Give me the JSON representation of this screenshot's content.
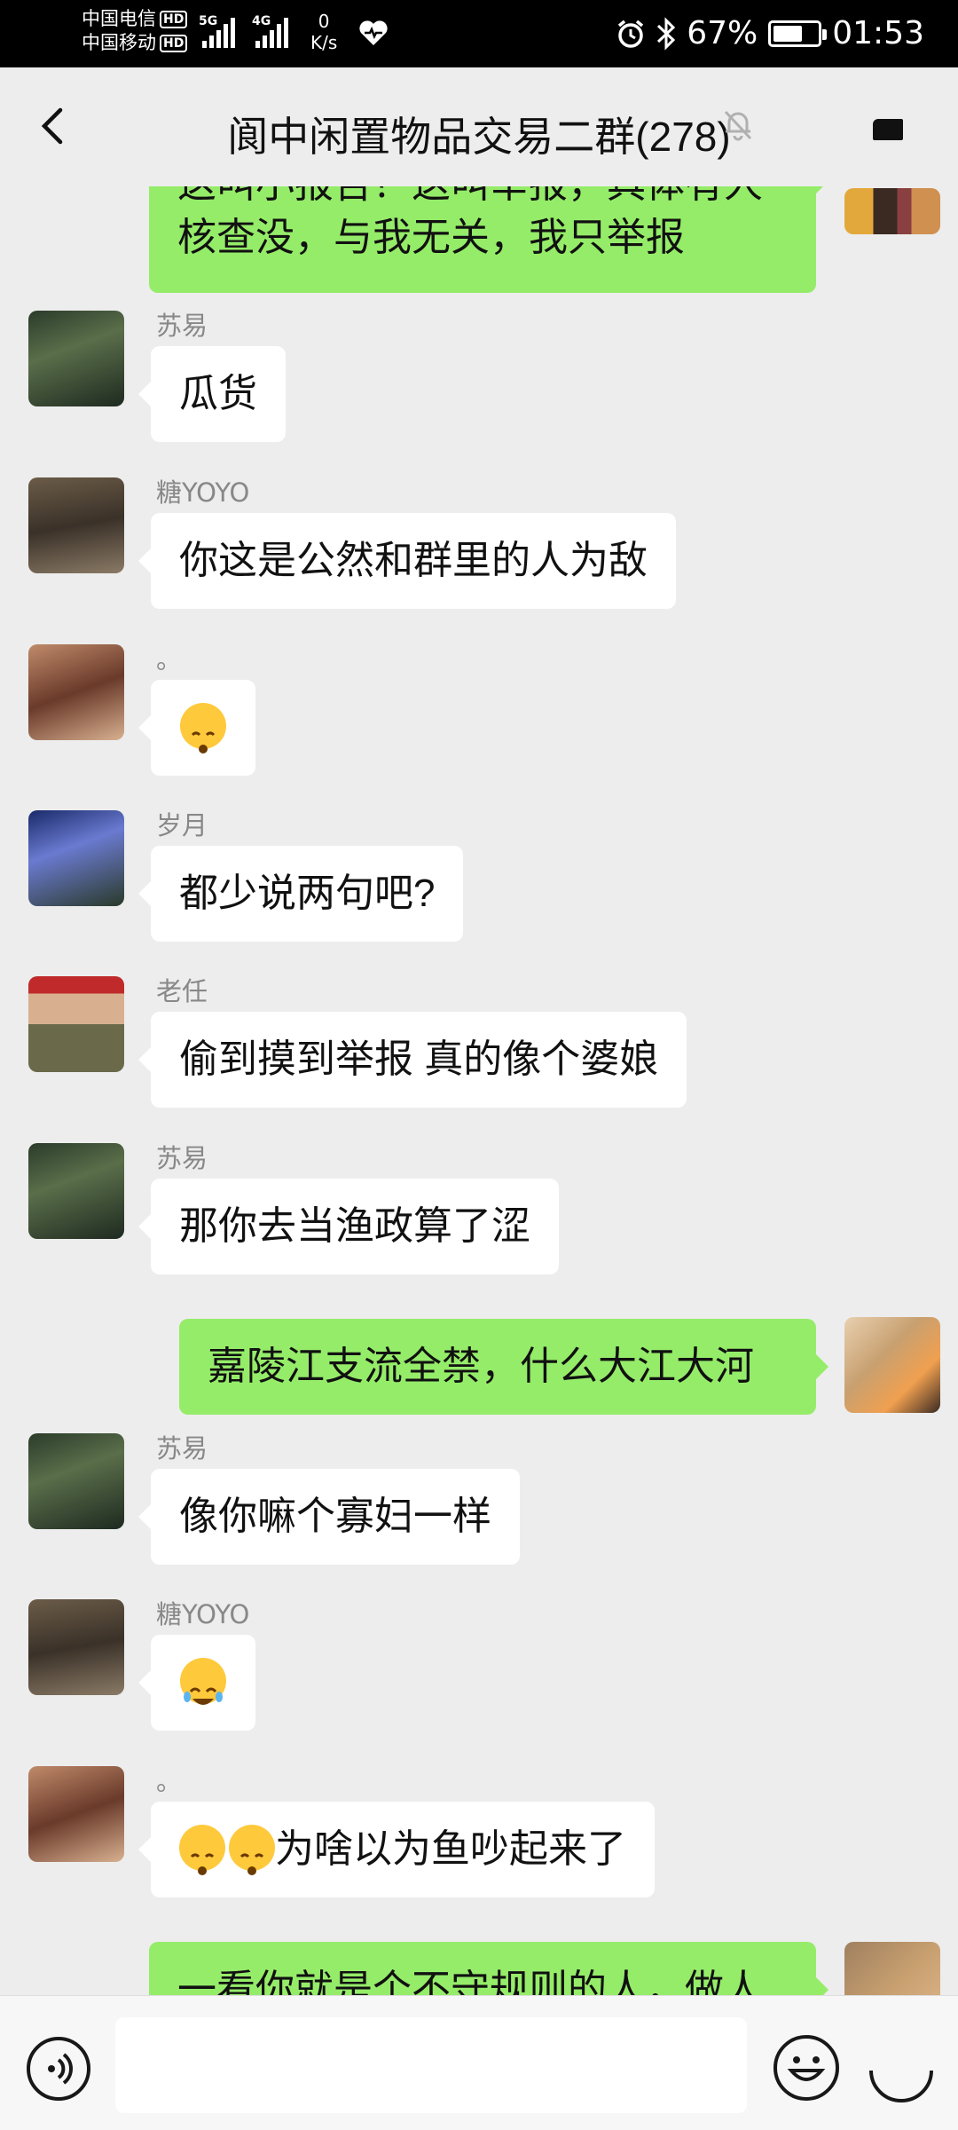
{
  "status_bar": {
    "carrier1": "中国电信",
    "carrier2": "中国移动",
    "hd": "HD",
    "net1": "5G",
    "net2": "4G",
    "speed_value": "0",
    "speed_unit": "K/s",
    "battery": "67%",
    "battery_level": 0.67,
    "time": "01:53"
  },
  "header": {
    "title": "阆中闲置物品交易二群(278)"
  },
  "messages": [
    {
      "side": "right",
      "text_line1": "这叫小报告？这叫举报，具体有人",
      "text_line2": "核查没，与我无关，我只举报"
    },
    {
      "side": "left",
      "sender": "苏易",
      "text": "瓜货"
    },
    {
      "side": "left",
      "sender": "糖YOYO",
      "text": "你这是公然和群里的人为敌"
    },
    {
      "side": "left",
      "sender": "。",
      "text": ""
    },
    {
      "side": "left",
      "sender": "岁月",
      "text": "都少说两句吧?"
    },
    {
      "side": "left",
      "sender": "老任",
      "text": "偷到摸到举报 真的像个婆娘"
    },
    {
      "side": "left",
      "sender": "苏易",
      "text": "那你去当渔政算了涩"
    },
    {
      "side": "right",
      "text": "嘉陵江支流全禁，什么大江大河"
    },
    {
      "side": "left",
      "sender": "苏易",
      "text": "像你嘛个寡妇一样"
    },
    {
      "side": "left",
      "sender": "糖YOYO",
      "text": ""
    },
    {
      "side": "left",
      "sender": "。",
      "text": "为啥以为鱼吵起来了"
    },
    {
      "side": "right",
      "text": "一看你就是个不守规则的人，做人"
    }
  ],
  "icons": {
    "back": "chevron-left-icon",
    "mute": "bell-off-icon",
    "more": "more-icon",
    "voice": "voice-icon",
    "emoji": "emoji-icon",
    "plus": "plus-icon"
  },
  "colors": {
    "bg": "#ededed",
    "bubble_self": "#95ec69",
    "bubble_other": "#ffffff",
    "name": "#888888"
  }
}
